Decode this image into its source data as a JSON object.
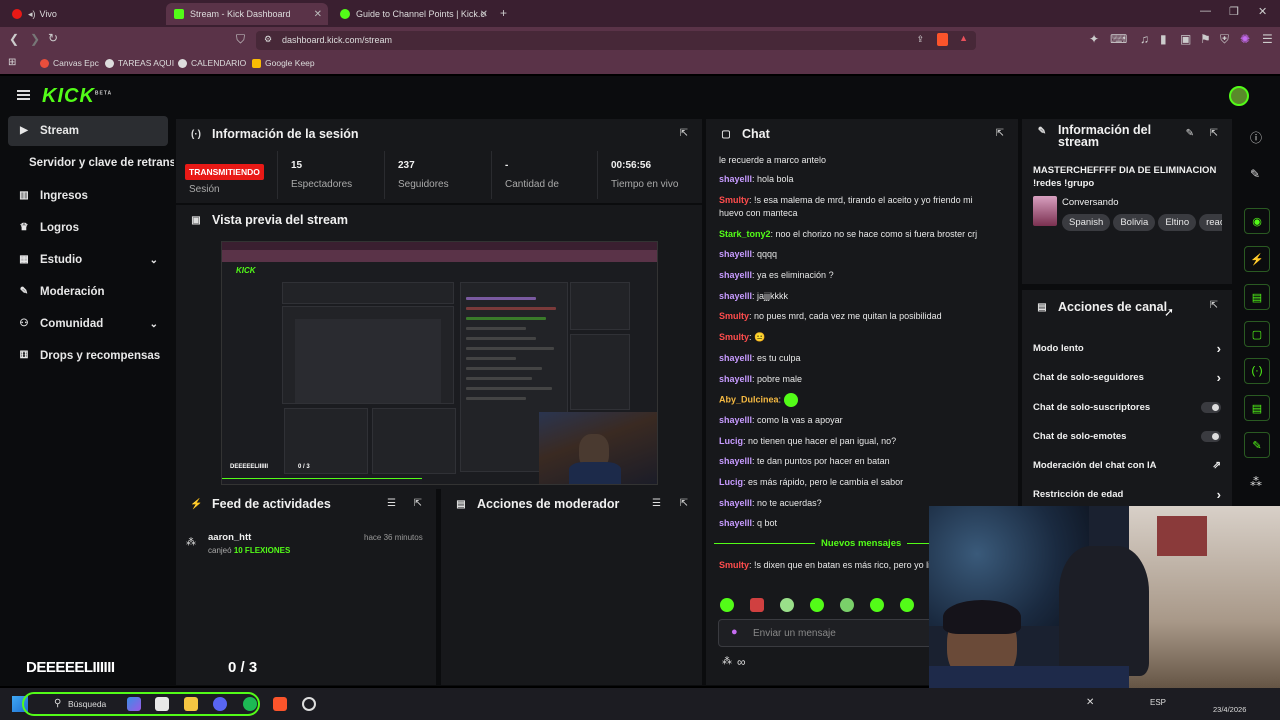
{
  "browser": {
    "tabs": [
      {
        "label": "Vivo"
      },
      {
        "label": "Stream - Kick Dashboard"
      },
      {
        "label": "Guide to Channel Points | Kick.com H"
      }
    ],
    "url": "dashboard.kick.com/stream",
    "bookmarks": [
      "Canvas Epc",
      "TAREAS AQUI",
      "CALENDARIO",
      "Google Keep"
    ]
  },
  "app": {
    "logo": "KICK",
    "logo_badge": "BETA"
  },
  "sidebar": {
    "items": [
      {
        "label": "Stream",
        "icon": "video-icon"
      },
      {
        "label": "Servidor y clave de retransmisión"
      },
      {
        "label": "Ingresos",
        "icon": "chart-icon"
      },
      {
        "label": "Logros",
        "icon": "trophy-icon"
      },
      {
        "label": "Estudio",
        "icon": "studio-icon"
      },
      {
        "label": "Moderación",
        "icon": "wrench-icon"
      },
      {
        "label": "Comunidad",
        "icon": "people-icon"
      },
      {
        "label": "Drops y recompensas",
        "icon": "gift-icon"
      }
    ]
  },
  "session": {
    "title": "Información de la sesión",
    "status": "TRANSMITIENDO",
    "status_label": "Sesión",
    "stats": [
      {
        "value": "15",
        "label": "Espectadores"
      },
      {
        "value": "237",
        "label": "Seguidores"
      },
      {
        "value": "-",
        "label": "Cantidad de"
      },
      {
        "value": "00:56:56",
        "label": "Tiempo en vivo"
      }
    ]
  },
  "preview": {
    "title": "Vista previa del stream"
  },
  "feed": {
    "title": "Feed de actividades",
    "items": [
      {
        "user": "aaron_htt",
        "time": "hace 36 minutos",
        "action": "canjeó",
        "reward": "10 FLEXIONES"
      }
    ],
    "overlay_text": "DEEEEELIIIIII",
    "overlay_counter": "0 / 3"
  },
  "moderator": {
    "title": "Acciones de moderador"
  },
  "chat": {
    "title": "Chat",
    "messages": [
      {
        "user": "",
        "text": "le recuerde a marco antelo",
        "color": "#e8e8e8"
      },
      {
        "user": "shayelll",
        "text": ": hola bola",
        "color": "#c79bff"
      },
      {
        "user": "Smulty",
        "text": ": !s esa malema de mrd, tirando el aceito y yo friendo mi huevo con manteca",
        "color": "#ff4d4d"
      },
      {
        "user": "Stark_tony2",
        "text": ": noo el chorizo no se hace como si fuera broster crj",
        "color": "#53fc18"
      },
      {
        "user": "shayelll",
        "text": ": qqqq",
        "color": "#c79bff"
      },
      {
        "user": "shayelll",
        "text": ": ya es eliminación ?",
        "color": "#c79bff"
      },
      {
        "user": "shayelll",
        "text": ": jajjjkkkk",
        "color": "#c79bff"
      },
      {
        "user": "Smulty",
        "text": ": no pues mrd, cada vez me quitan la posibilidad",
        "color": "#ff4d4d"
      },
      {
        "user": "Smulty",
        "text": ": 😐",
        "color": "#ff4d4d"
      },
      {
        "user": "shayelll",
        "text": ": es tu culpa",
        "color": "#c79bff"
      },
      {
        "user": "shayelll",
        "text": ": pobre male",
        "color": "#c79bff"
      },
      {
        "user": "Aby_Dulcinea",
        "text": ": ",
        "color": "#f5b942"
      },
      {
        "user": "shayelll",
        "text": ": como la vas a apoyar",
        "color": "#c79bff"
      },
      {
        "user": "Lucig",
        "text": ": no tienen que hacer el pan igual, no?",
        "color": "#c79bff"
      },
      {
        "user": "shayelll",
        "text": ": te dan puntos por hacer en batan",
        "color": "#c79bff"
      },
      {
        "user": "Lucig",
        "text": ": es más rápido, pero le cambia el sabor",
        "color": "#c79bff"
      },
      {
        "user": "shayelll",
        "text": ": no te acuerdas?",
        "color": "#c79bff"
      },
      {
        "user": "shayelll",
        "text": ": q bot",
        "color": "#c79bff"
      }
    ],
    "new_messages": "Nuevos mensajes",
    "last_message": {
      "user": "Smulty",
      "text": ": !s dixen que en batan es más rico, pero yo licuadora",
      "color": "#ff4d4d"
    },
    "input_placeholder": "Enviar un mensaje",
    "infinity": "∞"
  },
  "stream_info": {
    "title": "Información del stream",
    "stream_title": "MASTERCHEFFFF DIA DE ELIMINACION !redes !grupo",
    "category": "Conversando",
    "tags": [
      "Spanish",
      "Bolivia",
      "Eltino",
      "reac"
    ]
  },
  "channel_actions": {
    "title": "Acciones de canal",
    "rows": [
      {
        "label": "Modo lento",
        "control": "arrow"
      },
      {
        "label": "Chat de solo-seguidores",
        "control": "arrow"
      },
      {
        "label": "Chat de solo-suscriptores",
        "control": "toggle"
      },
      {
        "label": "Chat de solo-emotes",
        "control": "toggle"
      },
      {
        "label": "Moderación del chat con IA",
        "control": "external"
      },
      {
        "label": "Restricción de edad",
        "control": "arrow"
      }
    ]
  },
  "taskbar": {
    "search": "Búsqueda",
    "lang": "ESP",
    "date": "23/4/2026"
  },
  "colors": {
    "kick_green": "#53fc18",
    "live_red": "#e91916",
    "panel": "#17181b"
  }
}
